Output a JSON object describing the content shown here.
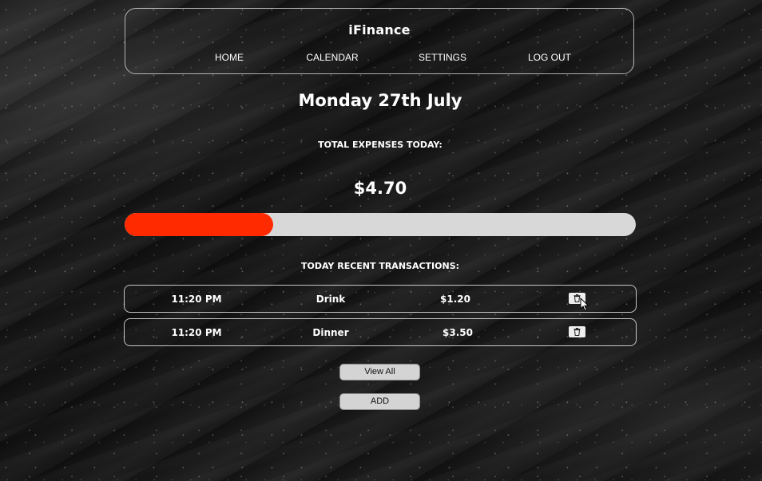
{
  "app": {
    "title": "iFinance"
  },
  "nav": {
    "items": [
      {
        "label": "HOME"
      },
      {
        "label": "CALENDAR"
      },
      {
        "label": "SETTINGS"
      },
      {
        "label": "LOG OUT"
      }
    ]
  },
  "main": {
    "date": "Monday 27th July",
    "expenses_label": "TOTAL EXPENSES TODAY:",
    "expenses_amount": "$4.70",
    "progress_fraction": 0.29,
    "recent_label": "TODAY RECENT TRANSACTIONS:"
  },
  "transactions": [
    {
      "time": "11:20 PM",
      "name": "Drink",
      "amount": "$1.20",
      "delete_icon": "trash-icon"
    },
    {
      "time": "11:20 PM",
      "name": "Dinner",
      "amount": "$3.50",
      "delete_icon": "trash-icon"
    }
  ],
  "buttons": {
    "view_all": "View All",
    "add": "ADD"
  },
  "colors": {
    "progress_fill": "#ff2a00",
    "progress_track": "#d9d8d9",
    "text": "#ffffff"
  }
}
